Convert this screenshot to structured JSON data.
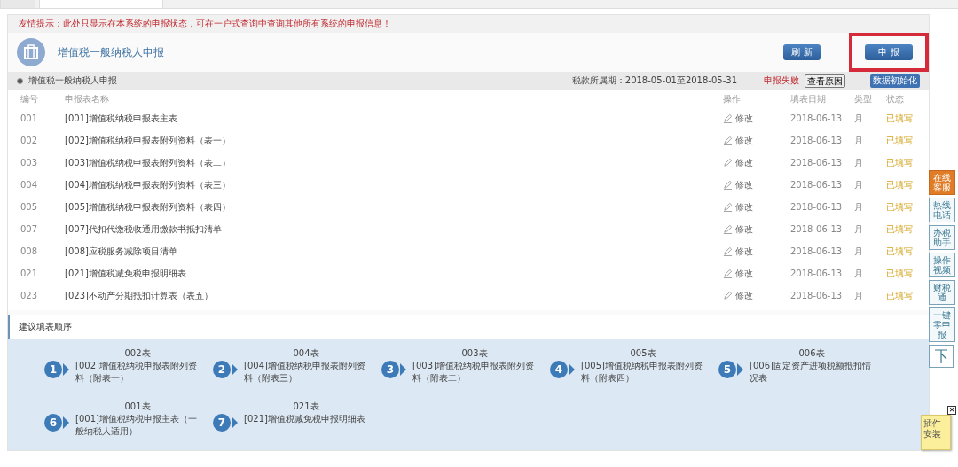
{
  "tabs": [
    {
      "selected": false
    },
    {
      "selected": true
    }
  ],
  "notice": "友情提示：此处只显示在本系统的申报状态，可在一户式查询中查询其他所有系统的申报信息！",
  "header": {
    "title": "增值税一般纳税人申报",
    "buttons": [
      {
        "label": "刷 新",
        "highlighted": false
      },
      {
        "label": "申 报",
        "highlighted": true
      }
    ]
  },
  "subbar": {
    "label": "增值税一般纳税人申报",
    "period": "税款所属期：2018-05-01至2018-05-31",
    "status": "申报失败",
    "reason_button": "查看原因",
    "init_button": "数据初始化"
  },
  "table": {
    "columns": [
      "编号",
      "申报表名称",
      "操作",
      "填表日期",
      "类型",
      "状态"
    ],
    "rows": [
      {
        "code": "001",
        "name": "[001]增值税纳税申报表主表",
        "action": "修改",
        "date": "2018-06-13",
        "type": "月",
        "status": "已填写"
      },
      {
        "code": "002",
        "name": "[002]增值税纳税申报表附列资料（表一）",
        "action": "修改",
        "date": "2018-06-13",
        "type": "月",
        "status": "已填写"
      },
      {
        "code": "003",
        "name": "[003]增值税纳税申报表附列资料（表二）",
        "action": "修改",
        "date": "2018-06-13",
        "type": "月",
        "status": "已填写"
      },
      {
        "code": "004",
        "name": "[004]增值税纳税申报表附列资料（表三）",
        "action": "修改",
        "date": "2018-06-13",
        "type": "月",
        "status": "已填写"
      },
      {
        "code": "005",
        "name": "[005]增值税纳税申报表附列资料（表四）",
        "action": "修改",
        "date": "2018-06-13",
        "type": "月",
        "status": "已填写"
      },
      {
        "code": "007",
        "name": "[007]代扣代缴税收通用缴款书抵扣清单",
        "action": "修改",
        "date": "2018-06-13",
        "type": "月",
        "status": "已填写"
      },
      {
        "code": "008",
        "name": "[008]应税服务减除项目清单",
        "action": "修改",
        "date": "2018-06-13",
        "type": "月",
        "status": "已填写"
      },
      {
        "code": "021",
        "name": "[021]增值税减免税申报明细表",
        "action": "修改",
        "date": "2018-06-13",
        "type": "月",
        "status": "已填写"
      },
      {
        "code": "023",
        "name": "[023]不动产分期抵扣计算表（表五）",
        "action": "修改",
        "date": "2018-06-13",
        "type": "月",
        "status": "已填写"
      }
    ]
  },
  "suggest": {
    "title": "建议填表顺序",
    "steps": [
      {
        "number": "1",
        "code": "002表",
        "name": "[002]增值税纳税申报表附列资料（附表一）"
      },
      {
        "number": "2",
        "code": "004表",
        "name": "[004]增值税纳税申报表附列资料（附表三）"
      },
      {
        "number": "3",
        "code": "003表",
        "name": "[003]增值税纳税申报表附列资料（附表二）"
      },
      {
        "number": "4",
        "code": "005表",
        "name": "[005]增值税纳税申报表附列资料（附表四）"
      },
      {
        "number": "5",
        "code": "006表",
        "name": "[006]固定资产进项税额抵扣情况表"
      },
      {
        "number": "6",
        "code": "001表",
        "name": "[001]增值税纳税申报主表（一般纳税人适用）"
      },
      {
        "number": "7",
        "code": "021表",
        "name": "[021]增值税减免税申报明细表"
      }
    ]
  },
  "side_tools": [
    {
      "label": "在线客服",
      "selected": true
    },
    {
      "label": "热线电话",
      "selected": false
    },
    {
      "label": "办税助手",
      "selected": false
    },
    {
      "label": "操作视频",
      "selected": false
    },
    {
      "label": "财税通",
      "selected": false
    },
    {
      "label": "一键零申报",
      "selected": false
    }
  ],
  "plugin": {
    "label": "插件安装",
    "close": "✕"
  }
}
